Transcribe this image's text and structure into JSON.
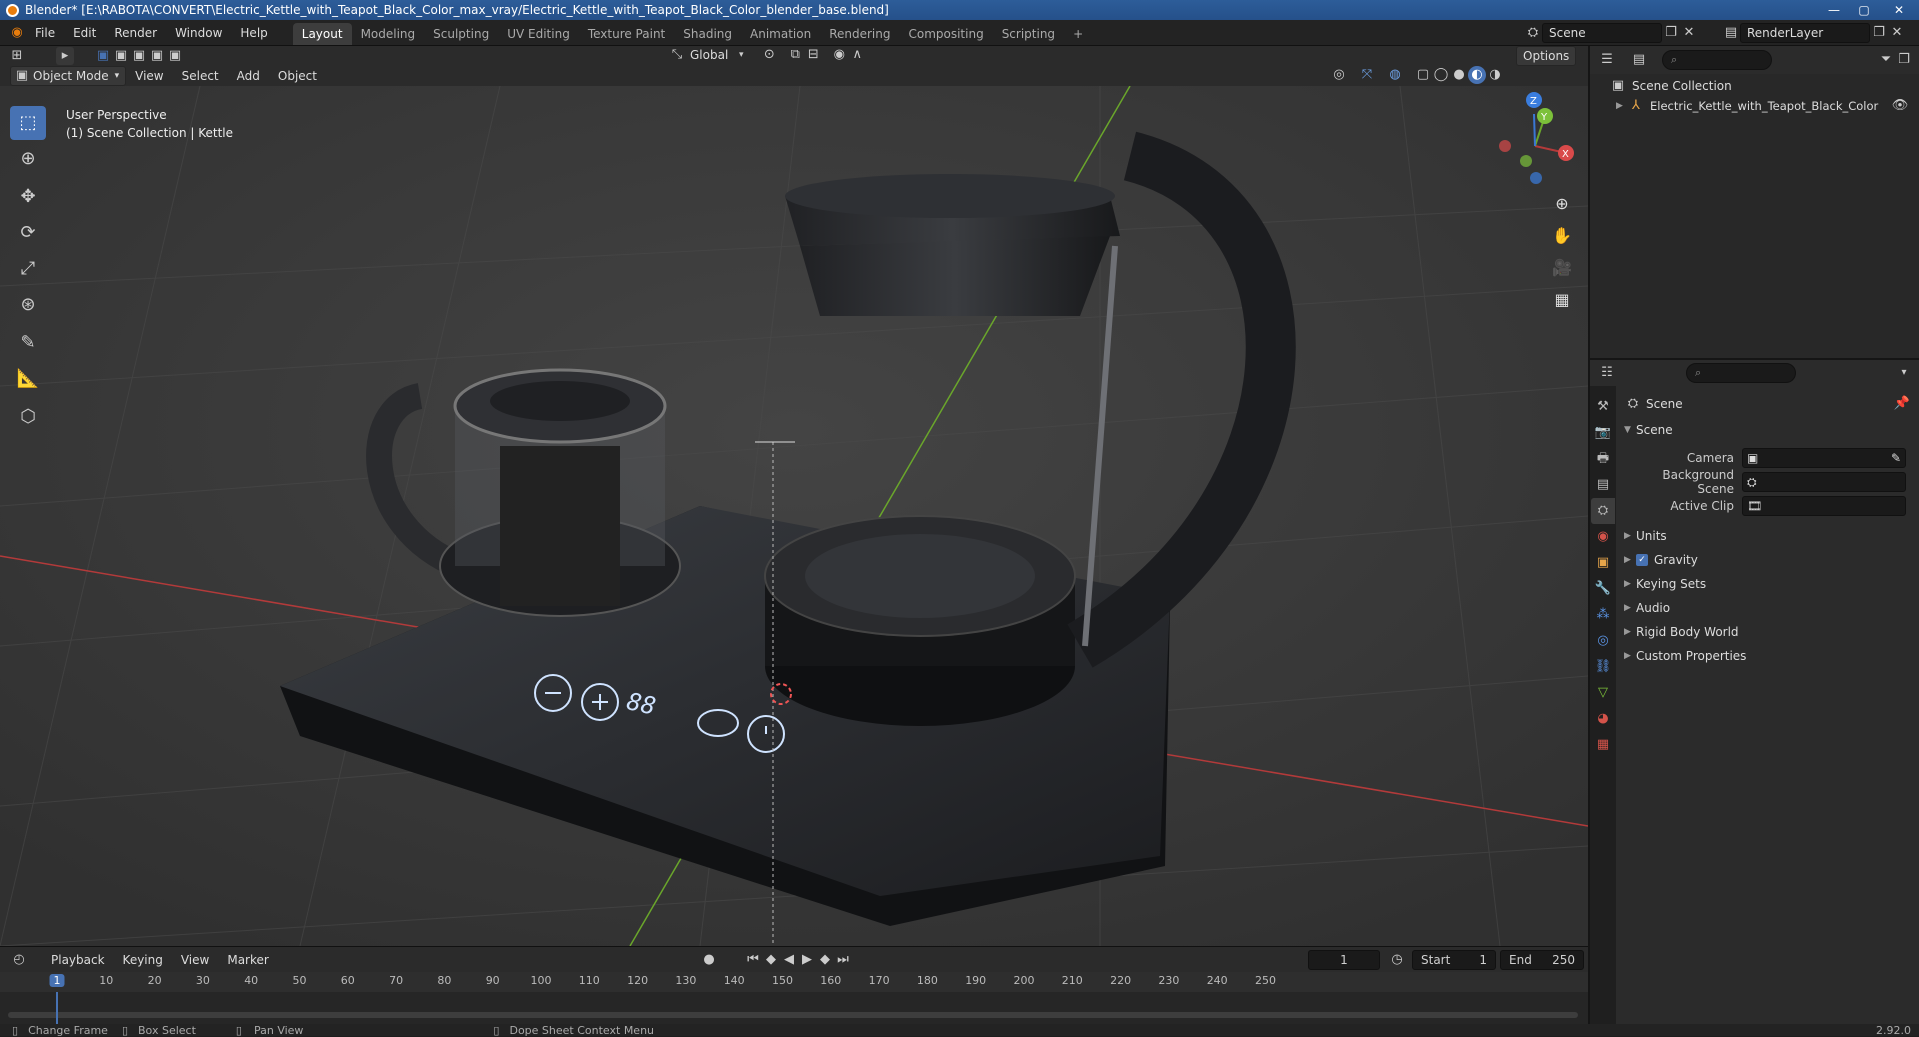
{
  "window": {
    "title": "Blender* [E:\\RABOTA\\CONVERT\\Electric_Kettle_with_Teapot_Black_Color_max_vray/Electric_Kettle_with_Teapot_Black_Color_blender_base.blend]",
    "minimize": "—",
    "maximize": "▢",
    "close": "✕"
  },
  "menu": {
    "items": [
      "File",
      "Edit",
      "Render",
      "Window",
      "Help"
    ]
  },
  "workspaces": {
    "tabs": [
      "Layout",
      "Modeling",
      "Sculpting",
      "UV Editing",
      "Texture Paint",
      "Shading",
      "Animation",
      "Rendering",
      "Compositing",
      "Scripting"
    ],
    "active": "Layout",
    "add": "+"
  },
  "top_right": {
    "scene": "Scene",
    "view_layer": "RenderLayer"
  },
  "viewport_header": {
    "mode": "Object Mode",
    "menus": [
      "View",
      "Select",
      "Add",
      "Object"
    ],
    "orientation": "Global",
    "options": "Options"
  },
  "viewport": {
    "perspective": "User Perspective",
    "collection": "(1) Scene Collection | Kettle",
    "kettle_display": "88"
  },
  "gizmo": {
    "x": "X",
    "y": "Y",
    "z": "Z"
  },
  "outliner": {
    "root": "Scene Collection",
    "item": "Electric_Kettle_with_Teapot_Black_Color"
  },
  "properties": {
    "context": "Scene",
    "section": "Scene",
    "camera_label": "Camera",
    "background_scene_label": "Background Scene",
    "active_clip_label": "Active Clip",
    "panels": [
      "Units",
      "Gravity",
      "Keying Sets",
      "Audio",
      "Rigid Body World",
      "Custom Properties"
    ],
    "gravity_checked": true
  },
  "timeline": {
    "menus": [
      "Playback",
      "Keying",
      "View",
      "Marker"
    ],
    "current_frame": "1",
    "start_label": "Start",
    "start": "1",
    "end_label": "End",
    "end": "250",
    "ruler": [
      "1",
      "10",
      "20",
      "30",
      "40",
      "50",
      "60",
      "70",
      "80",
      "90",
      "100",
      "110",
      "120",
      "130",
      "140",
      "150",
      "160",
      "170",
      "180",
      "190",
      "200",
      "210",
      "220",
      "230",
      "240",
      "250"
    ]
  },
  "statusbar": {
    "change_frame": "Change Frame",
    "box_select": "Box Select",
    "pan_view": "Pan View",
    "context_menu": "Dope Sheet Context Menu",
    "version": "2.92.0"
  },
  "colors": {
    "accent": "#4772b3",
    "x_axis": "#b33a3a",
    "y_axis": "#6aa62b",
    "z_axis": "#3a77d4",
    "playhead": "#4772b3"
  }
}
